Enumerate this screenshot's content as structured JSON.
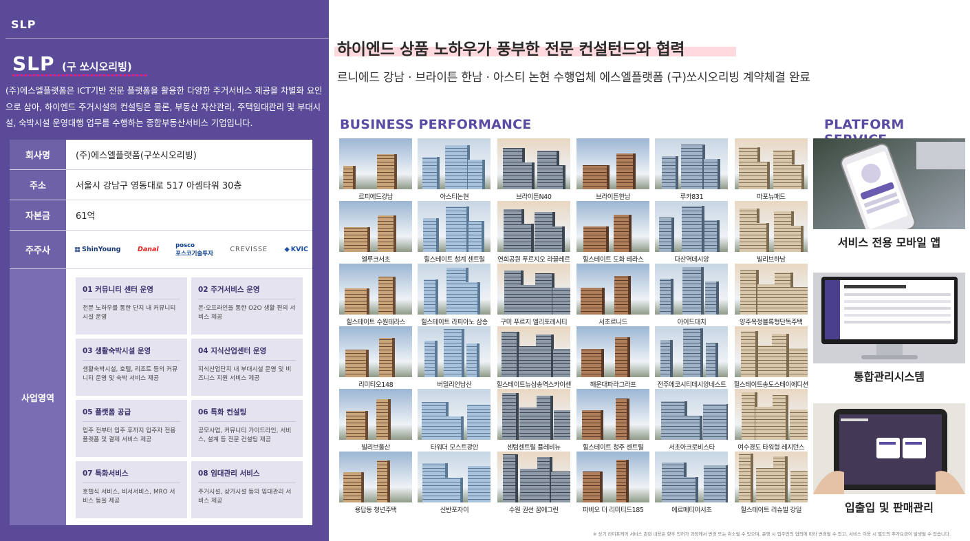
{
  "left": {
    "brand_small": "SLP",
    "logo": "SLP",
    "logo_sub": "(구 쏘시오리빙)",
    "intro": "(주)에스엘플랫폼은 ICT기반 전문 플랫폼을 활용한 다양한 주거서비스 제공을 차별화 요인으로 삼아, 하이엔드 주거시설의 컨설팅은 물론, 부동산 자산관리, 주택임대관리 및 부대시설, 숙박시설 운영대행 업무를 수행하는 종합부동산서비스 기업입니다.",
    "table": {
      "company_label": "회사명",
      "company_value": "(주)에스엘플랫폼(구쏘시오리빙)",
      "address_label": "주소",
      "address_value": "서울시 강남구 영동대로 517 아셈타워 30층",
      "capital_label": "자본금",
      "capital_value": "61억",
      "shareholders_label": "주주사",
      "shareholders": [
        "ShinYoung",
        "Danal",
        "posco",
        "포스코기술투자",
        "CREVISSE",
        "KVIC"
      ],
      "business_label": "사업영역",
      "business": [
        {
          "title": "01 커뮤니티 센터 운영",
          "desc": "전문 노하우를 통한 단지 내 커뮤니티 시설 운영"
        },
        {
          "title": "02 주거서비스 운영",
          "desc": "온·오프라인을 통한 O2O 생활 편의 서비스 제공"
        },
        {
          "title": "03 생활숙박시설 운영",
          "desc": "생활숙박시설, 호텔, 리조트 등의 커뮤니티 운영 및 숙박 서비스 제공"
        },
        {
          "title": "04 지식산업센터 운영",
          "desc": "지식산업단지 내 부대시설 운영 및 비즈니스 지원 서비스 제공"
        },
        {
          "title": "05 플랫폼 공급",
          "desc": "입주 전부터 입주 후까지 입주자 전용 플랫폼 및 결제 서비스 제공"
        },
        {
          "title": "06 특화 컨설팅",
          "desc": "공모사업, 커뮤니티 가이드라인, 서비스, 설계 등 전문 컨설팅 제공"
        },
        {
          "title": "07 특화서비스",
          "desc": "호텔식 서비스, 비서서비스, MRO 서비스 등을 제공"
        },
        {
          "title": "08 임대관리 서비스",
          "desc": "주거시설, 상가시설 등의 임대관리 서비스 제공"
        }
      ]
    }
  },
  "right": {
    "headline": "하이엔드 상품 노하우가 풍부한 전문 컨설턴드와 협력",
    "subhead": "르니에드 강남 · 브라이튼 한남 · 아스티 논현 수행업체 에스엘플랫폼 (구)쏘시오리빙 계약체결 완료",
    "business_title": "BUSINESS PERFORMANCE",
    "platform_title": "PLATFORM SERVICE",
    "projects": [
      "르피에드강남",
      "아스티논현",
      "브라이튼N40",
      "브라이튼한남",
      "루카831",
      "마포뉴매드",
      "엘루크서초",
      "힐스테이트 청계 센트럴",
      "연희공원 푸르지오 라끌레르",
      "힐스테이트 도화 테라스",
      "다산역데시앙",
      "빌리브하남",
      "힐스테이트 수원테라스",
      "힐스테이트 라피아노 삼송",
      "구미 푸르지 엘리포레시티",
      "서초르니드",
      "아이드대치",
      "양주옥정블록형단독주택",
      "리미티오148",
      "버밀리언남산",
      "힐스테이트뉴삼송역스카이센",
      "해운대파라그라프",
      "전주에코시티데시앙네스트",
      "힐스테이트송도스테이에디션",
      "빌리브울산",
      "타워더 모스트광안",
      "센텀센트럴 플레비뉴",
      "힐스테이트 청주 센트럴",
      "서초아크로비스타",
      "여수경도 타워형 레지던스",
      "용답동 청년주택",
      "신반포자이",
      "수원 권선 꿈에그린",
      "파비오 더 리미티드185",
      "에르메티아서초",
      "힐스테이트 리슈빌 강일"
    ],
    "services": [
      "서비스 전용 모바일 앱",
      "통합관리시스템",
      "입출입 및 판매관리"
    ],
    "footnote": "※ 상기 라이프케어 서비스 관련 내용은 향후 인허가 과정에서 변경 또는 취소될 수 있으며, 운영 시 입주민의 협의에 따라 변경될 수 있고, 서비스 이용 시 별도의 추가요금이 발생될 수 있습니다."
  },
  "colors": {
    "panel": "#5a4a98",
    "label": "#6f61a8",
    "accent": "#5b4ba3",
    "card": "#e6e3f0"
  }
}
